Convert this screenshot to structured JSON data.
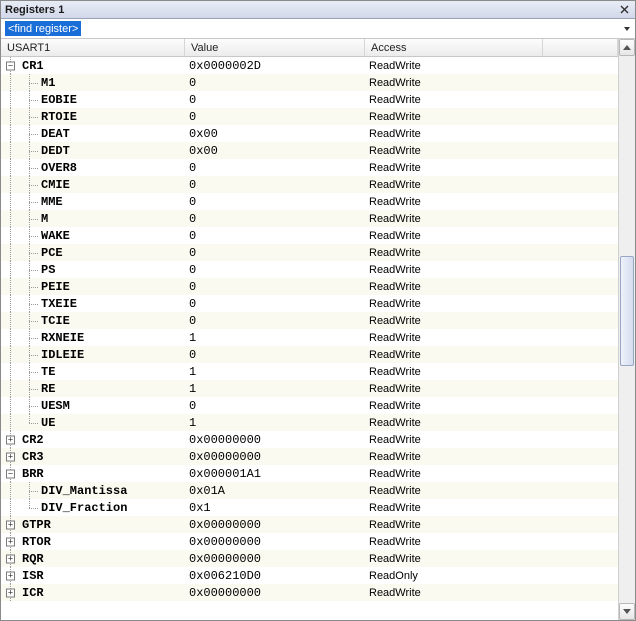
{
  "window": {
    "title": "Registers 1"
  },
  "find": {
    "placeholder": "<find register>"
  },
  "columns": {
    "name": "USART1",
    "value": "Value",
    "access": "Access"
  },
  "expander": {
    "plus": "+",
    "minus": "−"
  },
  "rows": [
    {
      "depth": 0,
      "exp": "minus",
      "last": false,
      "name": "CR1",
      "value": "0x0000002D",
      "access": "ReadWrite"
    },
    {
      "depth": 1,
      "exp": null,
      "last": false,
      "name": "M1",
      "value": "0",
      "access": "ReadWrite"
    },
    {
      "depth": 1,
      "exp": null,
      "last": false,
      "name": "EOBIE",
      "value": "0",
      "access": "ReadWrite"
    },
    {
      "depth": 1,
      "exp": null,
      "last": false,
      "name": "RTOIE",
      "value": "0",
      "access": "ReadWrite"
    },
    {
      "depth": 1,
      "exp": null,
      "last": false,
      "name": "DEAT",
      "value": "0x00",
      "access": "ReadWrite"
    },
    {
      "depth": 1,
      "exp": null,
      "last": false,
      "name": "DEDT",
      "value": "0x00",
      "access": "ReadWrite"
    },
    {
      "depth": 1,
      "exp": null,
      "last": false,
      "name": "OVER8",
      "value": "0",
      "access": "ReadWrite"
    },
    {
      "depth": 1,
      "exp": null,
      "last": false,
      "name": "CMIE",
      "value": "0",
      "access": "ReadWrite"
    },
    {
      "depth": 1,
      "exp": null,
      "last": false,
      "name": "MME",
      "value": "0",
      "access": "ReadWrite"
    },
    {
      "depth": 1,
      "exp": null,
      "last": false,
      "name": "M",
      "value": "0",
      "access": "ReadWrite"
    },
    {
      "depth": 1,
      "exp": null,
      "last": false,
      "name": "WAKE",
      "value": "0",
      "access": "ReadWrite"
    },
    {
      "depth": 1,
      "exp": null,
      "last": false,
      "name": "PCE",
      "value": "0",
      "access": "ReadWrite"
    },
    {
      "depth": 1,
      "exp": null,
      "last": false,
      "name": "PS",
      "value": "0",
      "access": "ReadWrite"
    },
    {
      "depth": 1,
      "exp": null,
      "last": false,
      "name": "PEIE",
      "value": "0",
      "access": "ReadWrite"
    },
    {
      "depth": 1,
      "exp": null,
      "last": false,
      "name": "TXEIE",
      "value": "0",
      "access": "ReadWrite"
    },
    {
      "depth": 1,
      "exp": null,
      "last": false,
      "name": "TCIE",
      "value": "0",
      "access": "ReadWrite"
    },
    {
      "depth": 1,
      "exp": null,
      "last": false,
      "name": "RXNEIE",
      "value": "1",
      "access": "ReadWrite"
    },
    {
      "depth": 1,
      "exp": null,
      "last": false,
      "name": "IDLEIE",
      "value": "0",
      "access": "ReadWrite"
    },
    {
      "depth": 1,
      "exp": null,
      "last": false,
      "name": "TE",
      "value": "1",
      "access": "ReadWrite"
    },
    {
      "depth": 1,
      "exp": null,
      "last": false,
      "name": "RE",
      "value": "1",
      "access": "ReadWrite"
    },
    {
      "depth": 1,
      "exp": null,
      "last": false,
      "name": "UESM",
      "value": "0",
      "access": "ReadWrite"
    },
    {
      "depth": 1,
      "exp": null,
      "last": true,
      "name": "UE",
      "value": "1",
      "access": "ReadWrite"
    },
    {
      "depth": 0,
      "exp": "plus",
      "last": false,
      "name": "CR2",
      "value": "0x00000000",
      "access": "ReadWrite"
    },
    {
      "depth": 0,
      "exp": "plus",
      "last": false,
      "name": "CR3",
      "value": "0x00000000",
      "access": "ReadWrite"
    },
    {
      "depth": 0,
      "exp": "minus",
      "last": false,
      "name": "BRR",
      "value": "0x000001A1",
      "access": "ReadWrite"
    },
    {
      "depth": 1,
      "exp": null,
      "last": false,
      "name": "DIV_Mantissa",
      "value": "0x01A",
      "access": "ReadWrite"
    },
    {
      "depth": 1,
      "exp": null,
      "last": true,
      "name": "DIV_Fraction",
      "value": "0x1",
      "access": "ReadWrite"
    },
    {
      "depth": 0,
      "exp": "plus",
      "last": false,
      "name": "GTPR",
      "value": "0x00000000",
      "access": "ReadWrite"
    },
    {
      "depth": 0,
      "exp": "plus",
      "last": false,
      "name": "RTOR",
      "value": "0x00000000",
      "access": "ReadWrite"
    },
    {
      "depth": 0,
      "exp": "plus",
      "last": false,
      "name": "RQR",
      "value": "0x00000000",
      "access": "ReadWrite"
    },
    {
      "depth": 0,
      "exp": "plus",
      "last": false,
      "name": "ISR",
      "value": "0x006210D0",
      "access": "ReadOnly"
    },
    {
      "depth": 0,
      "exp": "plus",
      "last": false,
      "name": "ICR",
      "value": "0x00000000",
      "access": "ReadWrite"
    }
  ]
}
